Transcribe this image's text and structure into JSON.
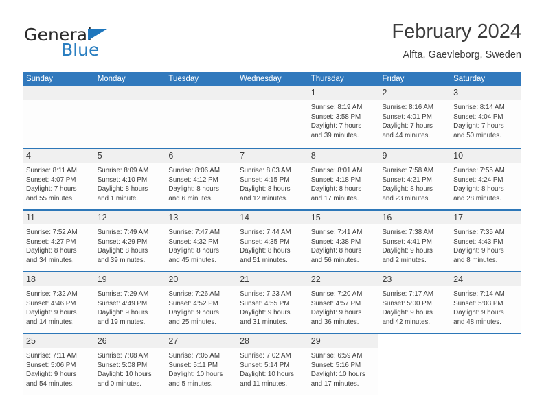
{
  "brand": {
    "name_top": "General",
    "name_bottom": "Blue",
    "accent_color": "#2a7ec0",
    "triangle_color": "#1f77bd"
  },
  "header": {
    "title": "February 2024",
    "location": "Alfta, Gaevleborg, Sweden",
    "header_bg": "#3179bd",
    "row_rule_color": "#2d77b8",
    "daynum_band_bg": "#f0f0f0"
  },
  "weekdays": [
    "Sunday",
    "Monday",
    "Tuesday",
    "Wednesday",
    "Thursday",
    "Friday",
    "Saturday"
  ],
  "weeks": [
    {
      "days": [
        {
          "date": "",
          "empty": true,
          "sunrise": "",
          "sunset": "",
          "daylight_1": "",
          "daylight_2": ""
        },
        {
          "date": "",
          "empty": true,
          "sunrise": "",
          "sunset": "",
          "daylight_1": "",
          "daylight_2": ""
        },
        {
          "date": "",
          "empty": true,
          "sunrise": "",
          "sunset": "",
          "daylight_1": "",
          "daylight_2": ""
        },
        {
          "date": "",
          "empty": true,
          "sunrise": "",
          "sunset": "",
          "daylight_1": "",
          "daylight_2": ""
        },
        {
          "date": "1",
          "empty": false,
          "sunrise": "Sunrise: 8:19 AM",
          "sunset": "Sunset: 3:58 PM",
          "daylight_1": "Daylight: 7 hours",
          "daylight_2": "and 39 minutes."
        },
        {
          "date": "2",
          "empty": false,
          "sunrise": "Sunrise: 8:16 AM",
          "sunset": "Sunset: 4:01 PM",
          "daylight_1": "Daylight: 7 hours",
          "daylight_2": "and 44 minutes."
        },
        {
          "date": "3",
          "empty": false,
          "sunrise": "Sunrise: 8:14 AM",
          "sunset": "Sunset: 4:04 PM",
          "daylight_1": "Daylight: 7 hours",
          "daylight_2": "and 50 minutes."
        }
      ]
    },
    {
      "days": [
        {
          "date": "4",
          "empty": false,
          "sunrise": "Sunrise: 8:11 AM",
          "sunset": "Sunset: 4:07 PM",
          "daylight_1": "Daylight: 7 hours",
          "daylight_2": "and 55 minutes."
        },
        {
          "date": "5",
          "empty": false,
          "sunrise": "Sunrise: 8:09 AM",
          "sunset": "Sunset: 4:10 PM",
          "daylight_1": "Daylight: 8 hours",
          "daylight_2": "and 1 minute."
        },
        {
          "date": "6",
          "empty": false,
          "sunrise": "Sunrise: 8:06 AM",
          "sunset": "Sunset: 4:12 PM",
          "daylight_1": "Daylight: 8 hours",
          "daylight_2": "and 6 minutes."
        },
        {
          "date": "7",
          "empty": false,
          "sunrise": "Sunrise: 8:03 AM",
          "sunset": "Sunset: 4:15 PM",
          "daylight_1": "Daylight: 8 hours",
          "daylight_2": "and 12 minutes."
        },
        {
          "date": "8",
          "empty": false,
          "sunrise": "Sunrise: 8:01 AM",
          "sunset": "Sunset: 4:18 PM",
          "daylight_1": "Daylight: 8 hours",
          "daylight_2": "and 17 minutes."
        },
        {
          "date": "9",
          "empty": false,
          "sunrise": "Sunrise: 7:58 AM",
          "sunset": "Sunset: 4:21 PM",
          "daylight_1": "Daylight: 8 hours",
          "daylight_2": "and 23 minutes."
        },
        {
          "date": "10",
          "empty": false,
          "sunrise": "Sunrise: 7:55 AM",
          "sunset": "Sunset: 4:24 PM",
          "daylight_1": "Daylight: 8 hours",
          "daylight_2": "and 28 minutes."
        }
      ]
    },
    {
      "days": [
        {
          "date": "11",
          "empty": false,
          "sunrise": "Sunrise: 7:52 AM",
          "sunset": "Sunset: 4:27 PM",
          "daylight_1": "Daylight: 8 hours",
          "daylight_2": "and 34 minutes."
        },
        {
          "date": "12",
          "empty": false,
          "sunrise": "Sunrise: 7:49 AM",
          "sunset": "Sunset: 4:29 PM",
          "daylight_1": "Daylight: 8 hours",
          "daylight_2": "and 39 minutes."
        },
        {
          "date": "13",
          "empty": false,
          "sunrise": "Sunrise: 7:47 AM",
          "sunset": "Sunset: 4:32 PM",
          "daylight_1": "Daylight: 8 hours",
          "daylight_2": "and 45 minutes."
        },
        {
          "date": "14",
          "empty": false,
          "sunrise": "Sunrise: 7:44 AM",
          "sunset": "Sunset: 4:35 PM",
          "daylight_1": "Daylight: 8 hours",
          "daylight_2": "and 51 minutes."
        },
        {
          "date": "15",
          "empty": false,
          "sunrise": "Sunrise: 7:41 AM",
          "sunset": "Sunset: 4:38 PM",
          "daylight_1": "Daylight: 8 hours",
          "daylight_2": "and 56 minutes."
        },
        {
          "date": "16",
          "empty": false,
          "sunrise": "Sunrise: 7:38 AM",
          "sunset": "Sunset: 4:41 PM",
          "daylight_1": "Daylight: 9 hours",
          "daylight_2": "and 2 minutes."
        },
        {
          "date": "17",
          "empty": false,
          "sunrise": "Sunrise: 7:35 AM",
          "sunset": "Sunset: 4:43 PM",
          "daylight_1": "Daylight: 9 hours",
          "daylight_2": "and 8 minutes."
        }
      ]
    },
    {
      "days": [
        {
          "date": "18",
          "empty": false,
          "sunrise": "Sunrise: 7:32 AM",
          "sunset": "Sunset: 4:46 PM",
          "daylight_1": "Daylight: 9 hours",
          "daylight_2": "and 14 minutes."
        },
        {
          "date": "19",
          "empty": false,
          "sunrise": "Sunrise: 7:29 AM",
          "sunset": "Sunset: 4:49 PM",
          "daylight_1": "Daylight: 9 hours",
          "daylight_2": "and 19 minutes."
        },
        {
          "date": "20",
          "empty": false,
          "sunrise": "Sunrise: 7:26 AM",
          "sunset": "Sunset: 4:52 PM",
          "daylight_1": "Daylight: 9 hours",
          "daylight_2": "and 25 minutes."
        },
        {
          "date": "21",
          "empty": false,
          "sunrise": "Sunrise: 7:23 AM",
          "sunset": "Sunset: 4:55 PM",
          "daylight_1": "Daylight: 9 hours",
          "daylight_2": "and 31 minutes."
        },
        {
          "date": "22",
          "empty": false,
          "sunrise": "Sunrise: 7:20 AM",
          "sunset": "Sunset: 4:57 PM",
          "daylight_1": "Daylight: 9 hours",
          "daylight_2": "and 36 minutes."
        },
        {
          "date": "23",
          "empty": false,
          "sunrise": "Sunrise: 7:17 AM",
          "sunset": "Sunset: 5:00 PM",
          "daylight_1": "Daylight: 9 hours",
          "daylight_2": "and 42 minutes."
        },
        {
          "date": "24",
          "empty": false,
          "sunrise": "Sunrise: 7:14 AM",
          "sunset": "Sunset: 5:03 PM",
          "daylight_1": "Daylight: 9 hours",
          "daylight_2": "and 48 minutes."
        }
      ]
    },
    {
      "days": [
        {
          "date": "25",
          "empty": false,
          "sunrise": "Sunrise: 7:11 AM",
          "sunset": "Sunset: 5:06 PM",
          "daylight_1": "Daylight: 9 hours",
          "daylight_2": "and 54 minutes."
        },
        {
          "date": "26",
          "empty": false,
          "sunrise": "Sunrise: 7:08 AM",
          "sunset": "Sunset: 5:08 PM",
          "daylight_1": "Daylight: 10 hours",
          "daylight_2": "and 0 minutes."
        },
        {
          "date": "27",
          "empty": false,
          "sunrise": "Sunrise: 7:05 AM",
          "sunset": "Sunset: 5:11 PM",
          "daylight_1": "Daylight: 10 hours",
          "daylight_2": "and 5 minutes."
        },
        {
          "date": "28",
          "empty": false,
          "sunrise": "Sunrise: 7:02 AM",
          "sunset": "Sunset: 5:14 PM",
          "daylight_1": "Daylight: 10 hours",
          "daylight_2": "and 11 minutes."
        },
        {
          "date": "29",
          "empty": false,
          "sunrise": "Sunrise: 6:59 AM",
          "sunset": "Sunset: 5:16 PM",
          "daylight_1": "Daylight: 10 hours",
          "daylight_2": "and 17 minutes."
        }
      ],
      "trailing_blanks": 2
    }
  ]
}
